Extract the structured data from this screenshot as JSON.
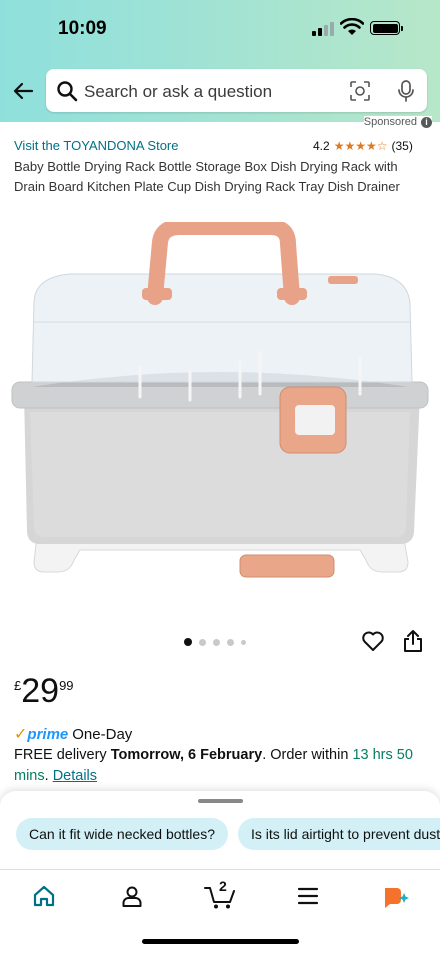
{
  "status_bar": {
    "time": "10:09"
  },
  "search": {
    "placeholder": "Search or ask a question"
  },
  "sponsored_label": "Sponsored",
  "product": {
    "store_link": "Visit the TOYANDONA Store",
    "rating_value": "4.2",
    "rating_stars": "★★★★☆",
    "rating_count": "(35)",
    "title": "Baby Bottle Drying Rack Bottle Storage Box Dish Drying Rack with Drain Board Kitchen Plate Cup Dish Drying Rack Tray Dish Drainer",
    "image_count": 5,
    "active_image": 1,
    "price": {
      "currency": "£",
      "whole": "29",
      "fraction": "99"
    }
  },
  "delivery": {
    "prime_check": "✓",
    "prime_word": "prime",
    "prime_speed": "One-Day",
    "free_delivery": "FREE delivery",
    "date": "Tomorrow, 6 February",
    "order_within_prefix": ". Order within",
    "time_left": "13 hrs 50 mins",
    "details_link": "Details"
  },
  "questions": [
    "Can it fit wide necked bottles?",
    "Is its lid airtight to prevent dust?"
  ],
  "tabbar": {
    "items": [
      "home-icon",
      "account-icon",
      "cart-icon",
      "menu-icon",
      "rufus-icon"
    ],
    "cart_count": "2"
  },
  "colors": {
    "header_gradient_start": "#8fe0dd",
    "link": "#007185",
    "star": "#de7921",
    "prime_blue": "#1a98ff",
    "green_text": "#067d62",
    "chip_bg": "#d2f0f5",
    "active_tab": "#007185"
  }
}
